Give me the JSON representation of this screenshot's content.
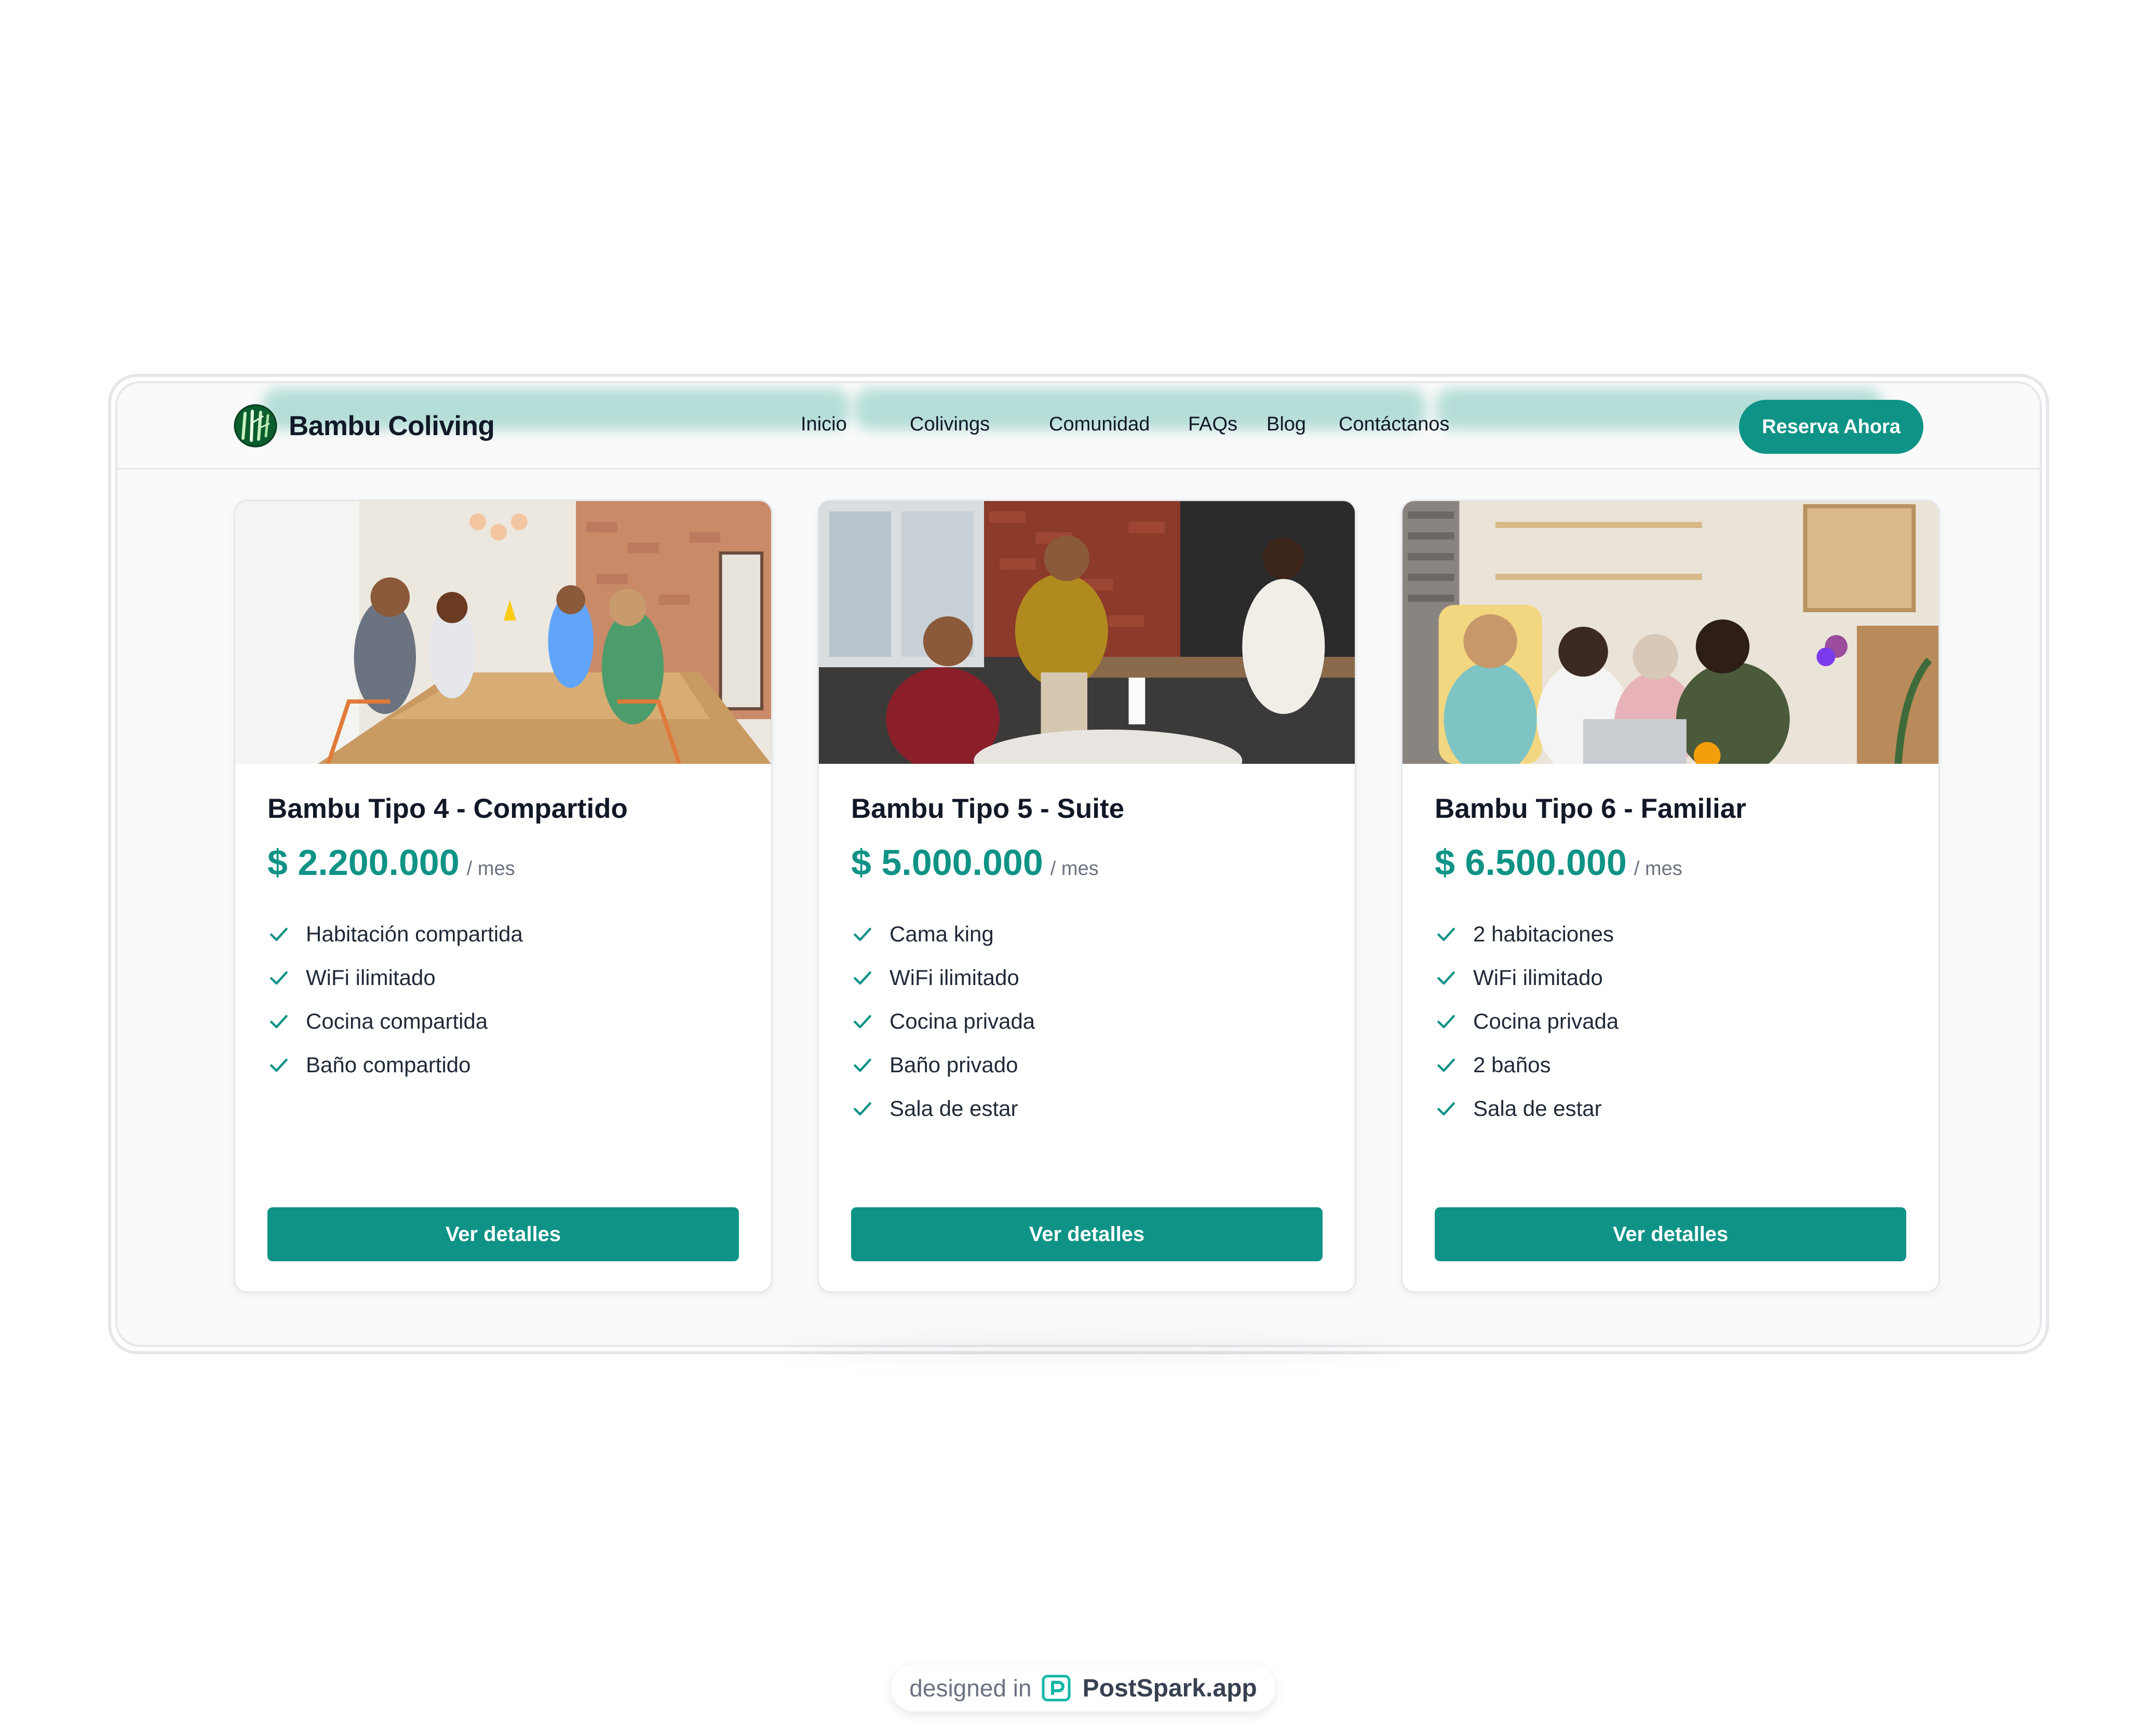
{
  "header": {
    "brand_name": "Bambu Coliving",
    "logo_icon": "bamboo-logo-icon",
    "nav": [
      "Inicio",
      "Colivings",
      "Comunidad",
      "FAQs",
      "Blog",
      "Contáctanos"
    ],
    "cta_label": "Reserva Ahora"
  },
  "colors": {
    "accent": "#0f9386",
    "text": "#111827",
    "muted": "#6b7280",
    "page": "#f9fafb"
  },
  "cards": [
    {
      "title": "Bambu Tipo 4 - Compartido",
      "price": "$ 2.200.000",
      "per": "/ mes",
      "features": [
        "Habitación compartida",
        "WiFi ilimitado",
        "Cocina compartida",
        "Baño compartido"
      ],
      "button": "Ver detalles"
    },
    {
      "title": "Bambu Tipo 5 - Suite",
      "price": "$ 5.000.000",
      "per": "/ mes",
      "features": [
        "Cama king",
        "WiFi ilimitado",
        "Cocina privada",
        "Baño privado",
        "Sala de estar"
      ],
      "button": "Ver detalles"
    },
    {
      "title": "Bambu Tipo 6 - Familiar",
      "price": "$ 6.500.000",
      "per": "/ mes",
      "features": [
        "2 habitaciones",
        "WiFi ilimitado",
        "Cocina privada",
        "2 baños",
        "Sala de estar"
      ],
      "button": "Ver detalles"
    }
  ],
  "credit": {
    "prefix": "designed in",
    "brand": "PostSpark.app",
    "icon": "postspark-icon"
  }
}
